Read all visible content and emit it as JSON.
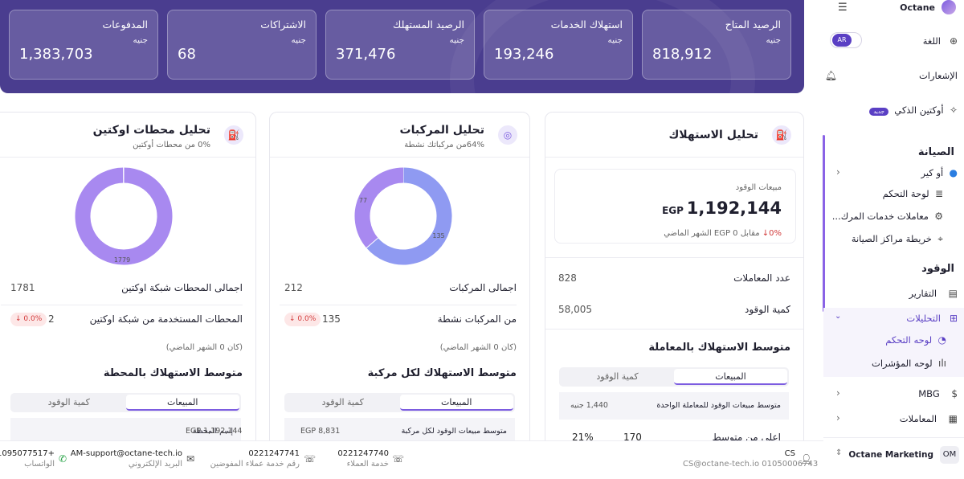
{
  "kpis": [
    {
      "title": "المدفوعات",
      "unit": "جنيه",
      "value": "1,383,703"
    },
    {
      "title": "الاشتراكات",
      "unit": "جنيه",
      "value": "68"
    },
    {
      "title": "الرصيد المستهلك",
      "unit": "جنيه",
      "value": "371,476"
    },
    {
      "title": "استهلاك الخدمات",
      "unit": "جنيه",
      "value": "193,246"
    },
    {
      "title": "الرصيد المتاح",
      "unit": "جنيه",
      "value": "818,912"
    }
  ],
  "stations": {
    "title": "تحليل محطات اوكتين",
    "subtitle": "0% من محطات أوكتين",
    "donut_values": [
      1779,
      2
    ],
    "donut_label": "1779",
    "total_label": "اجمالى المحطات شبكة اوكتين",
    "total_value": "1781",
    "used_label": "المحطات المستخدمة من شبكة اوكتين",
    "used_value": "2",
    "used_change": "0.0%",
    "prev_hint": "(كان 0 الشهر الماضي)",
    "avg_title": "متوسط الاستهلاك بالمحطة",
    "tab_sales": "المبيعات",
    "tab_qty": "كمية الوقود",
    "th_name": "إسم المحطة",
    "th_value": "EGP 1,192,144"
  },
  "vehicles": {
    "title": "تحليل المركبات",
    "subtitle": "64%من مركباتك نشطة",
    "donut_values": [
      135,
      77
    ],
    "donut_label_a": "135",
    "donut_label_b": "77",
    "total_label": "اجمالى المركبات",
    "total_value": "212",
    "active_label": "من المركبات نشطة",
    "active_value": "135",
    "active_change": "0.0%",
    "prev_hint": "(كان 0 الشهر الماضي)",
    "avg_title": "متوسط الاستهلاك لكل مركبة",
    "tab_sales": "المبيعات",
    "tab_qty": "كمية الوقود",
    "th_label": "متوسط مبيعات الوقود لكل مركبة",
    "th_value": "EGP 8,831"
  },
  "fuel": {
    "title": "تحليل الاستهلاك",
    "box_label": "مبيعات الوقود",
    "box_currency": "EGP",
    "box_value": "1,192,144",
    "box_change": "0%",
    "box_compare": "مقابل  EGP 0 الشهر الماضي",
    "tx_label": "عدد المعاملات",
    "tx_value": "828",
    "qty_label": "كمية الوقود",
    "qty_value": "58,005",
    "avg_title": "متوسط الاستهلاك بالمعاملة",
    "tab_sales": "المبيعات",
    "tab_qty": "كمية الوقود",
    "th_label": "متوسط مبيعات الوقود للمعاملة الواحدة",
    "th_value": "1,440 جنيه",
    "row_label": "اعلى من متوسط",
    "row_count": "170",
    "row_pct": "21%"
  },
  "sidebar": {
    "brand": "Octane",
    "language_label": "اللغة",
    "language_toggle": "AR",
    "notifications": "الإشعارات",
    "ai": "أوكتين الذكي",
    "ai_badge": "جديد",
    "maintenance_section": "الصيانة",
    "ocare": "أو كير",
    "dashboard": "لوحة التحكم",
    "service_tx": "معاملات خدمات المرك...",
    "service_map": "خريطة مراكز الصيانة",
    "fuel_section": "الوقود",
    "reports": "التقارير",
    "analytics": "التحليلات",
    "analytics_dashboard": "لوحه التحكم",
    "indicators": "لوحه المؤشرات",
    "mbg": "MBG",
    "transactions": "المعاملات",
    "account_name": "Octane Marketing",
    "account_initials": "OM"
  },
  "footer": {
    "user_name": "CS",
    "user_detail": "CS@octane-tech.io  01050006743",
    "cs_phone": "0221247740",
    "cs_label": "خدمة العملاء",
    "auth_phone": "0221247741",
    "auth_label": "رقم خدمة عملاء المفوضين",
    "email": "AM-support@octane-tech.io",
    "email_label": "البريد الإلكتروني",
    "whatsapp": "+201095077517",
    "whatsapp_label": "الواتساب"
  },
  "colors": {
    "band": "#4a3d8f",
    "accent": "#7c5ce0",
    "donut_purple": "#a889f0",
    "donut_blue": "#8f9af2",
    "negative": "#d23b3b"
  },
  "icons": {
    "whatsapp": "whatsapp-icon",
    "mail": "mail-icon",
    "phone": "phone-icon",
    "user": "user-icon"
  }
}
